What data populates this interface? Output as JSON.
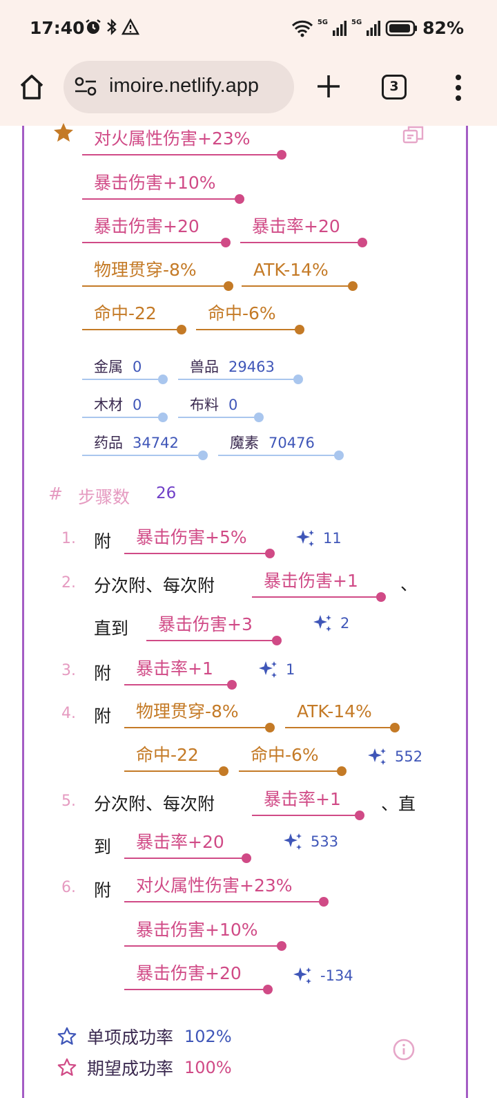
{
  "status_bar": {
    "time": "17:40",
    "battery": "82%",
    "network": [
      "5G",
      "5G"
    ],
    "icons": [
      "alarm-icon",
      "bluetooth-icon",
      "warning-icon",
      "wifi-icon",
      "signal-icon",
      "battery-icon"
    ]
  },
  "browser": {
    "url": "imoire.netlify.app",
    "tab_count": "3",
    "icons": [
      "home-icon",
      "site-settings-icon",
      "new-tab-icon",
      "tab-switcher-icon",
      "menu-icon"
    ]
  },
  "result": {
    "lines": [
      [
        {
          "text": "对火属性伤害+23%",
          "color": "pink"
        }
      ],
      [
        {
          "text": "暴击伤害+10%",
          "color": "pink"
        }
      ],
      [
        {
          "text": "暴击伤害+20",
          "color": "pink"
        },
        {
          "text": "暴击率+20",
          "color": "pink"
        }
      ],
      [
        {
          "text": "物理贯穿-8%",
          "color": "orange"
        },
        {
          "text": "ATK-14%",
          "color": "orange"
        }
      ],
      [
        {
          "text": "命中-22",
          "color": "orange"
        },
        {
          "text": "命中-6%",
          "color": "orange"
        }
      ]
    ],
    "materials": [
      [
        {
          "name": "金属",
          "value": "0"
        },
        {
          "name": "兽品",
          "value": "29463"
        }
      ],
      [
        {
          "name": "木材",
          "value": "0"
        },
        {
          "name": "布料",
          "value": "0"
        }
      ],
      [
        {
          "name": "药品",
          "value": "34742"
        },
        {
          "name": "魔素",
          "value": "70476"
        }
      ]
    ]
  },
  "steps": {
    "hash": "#",
    "label": "步骤数",
    "count": "26",
    "items": [
      {
        "num": "1.",
        "prefix": "附",
        "effects": [
          "暴击伤害+5%"
        ],
        "cost": "11"
      },
      {
        "num": "2.",
        "prefix": "分次附、每次附",
        "effects": [
          "暴击伤害+1"
        ],
        "separator": "、",
        "until": "直到",
        "until_effect": "暴击伤害+3",
        "cost": "2"
      },
      {
        "num": "3.",
        "prefix": "附",
        "effects": [
          "暴击率+1"
        ],
        "cost": "1"
      },
      {
        "num": "4.",
        "prefix": "附",
        "effects": [
          "物理贯穿-8%",
          "ATK-14%",
          "命中-22",
          "命中-6%"
        ],
        "cost": "552"
      },
      {
        "num": "5.",
        "prefix": "分次附、每次附",
        "effects": [
          "暴击率+1"
        ],
        "separator": "、直",
        "until": "到",
        "until_effect": "暴击率+20",
        "cost": "533"
      },
      {
        "num": "6.",
        "prefix": "附",
        "effects": [
          "对火属性伤害+23%",
          "暴击伤害+10%",
          "暴击伤害+20"
        ],
        "cost": "-134"
      }
    ]
  },
  "rates": {
    "single": {
      "label": "单项成功率",
      "value": "102%",
      "color": "#3f56b8"
    },
    "expected": {
      "label": "期望成功率",
      "value": "100%",
      "color": "#d04a86"
    }
  }
}
